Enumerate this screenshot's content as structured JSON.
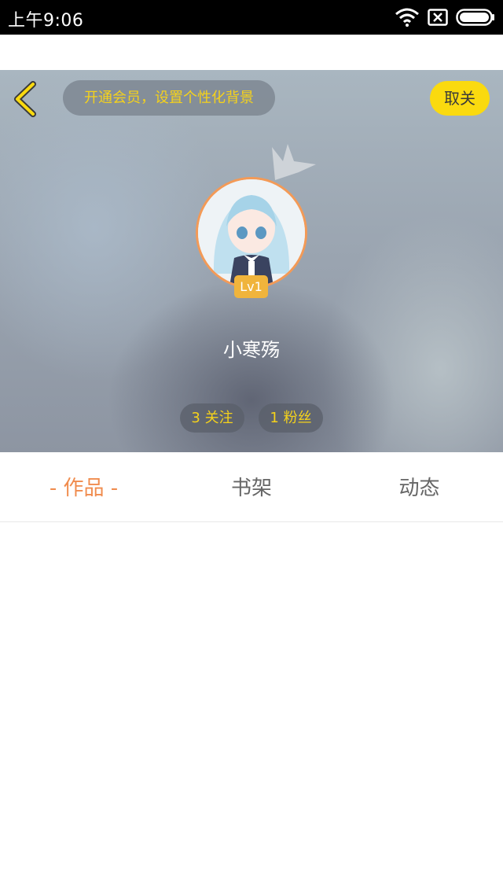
{
  "status_bar": {
    "time": "上午9:06",
    "icons": [
      "wifi-icon",
      "sim-off-icon",
      "battery-icon"
    ]
  },
  "header": {
    "back_icon": "chevron-left-icon",
    "vip_banner": "开通会员，设置个性化背景",
    "unfollow_label": "取关",
    "level": "Lv1",
    "username": "小寒殇",
    "follow_stat": "3 关注",
    "fans_stat": "1 粉丝"
  },
  "tabs": [
    {
      "label": "- 作品 -",
      "active": true
    },
    {
      "label": "书架",
      "active": false
    },
    {
      "label": "动态",
      "active": false
    }
  ],
  "colors": {
    "accent_yellow": "#fada0f",
    "active_tab": "#f08c4e",
    "avatar_ring": "#f39a57",
    "level_badge": "#f0b43c"
  }
}
